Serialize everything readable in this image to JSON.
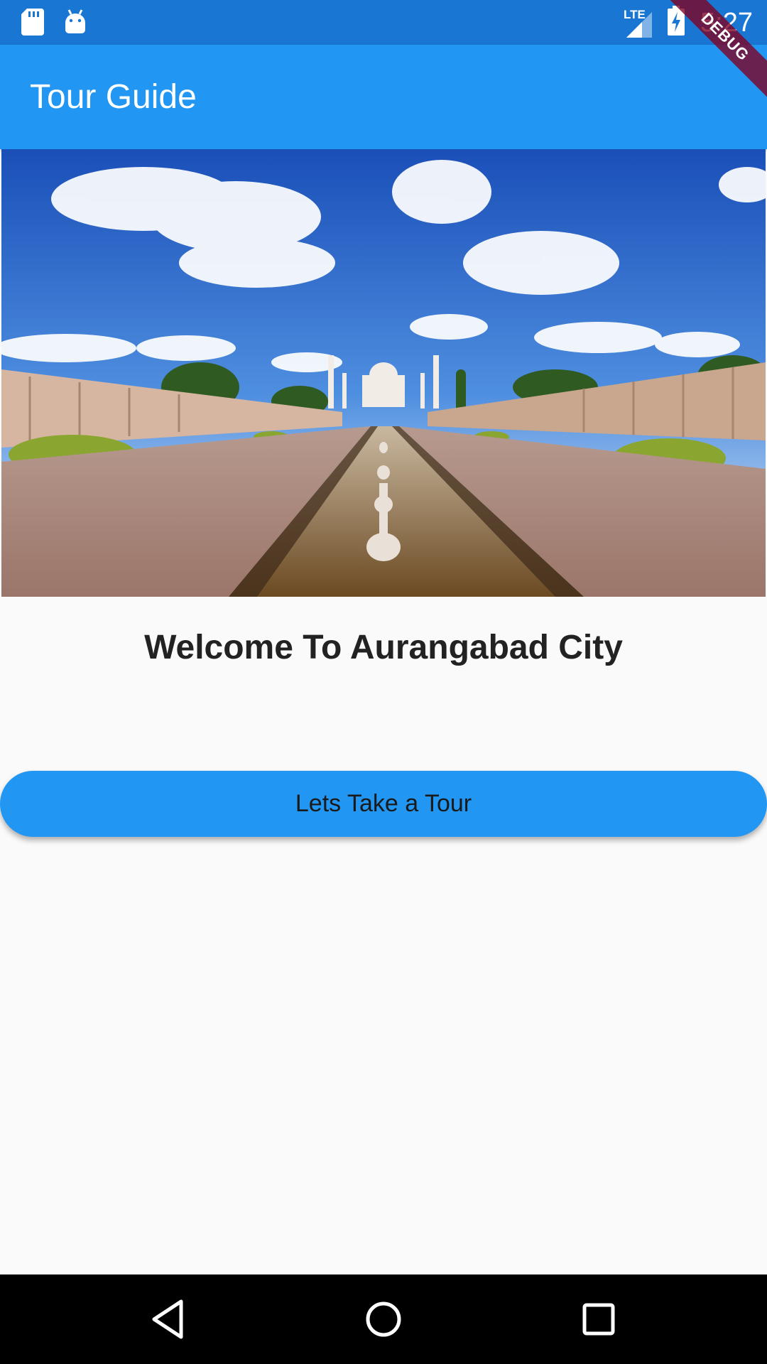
{
  "status_bar": {
    "time": "5:27",
    "network": "LTE",
    "icons": [
      "sd-card-icon",
      "android-icon",
      "signal-icon",
      "battery-charging-icon"
    ]
  },
  "debug_banner": "DEBUG",
  "app_bar": {
    "title": "Tour Guide"
  },
  "hero": {
    "image": "aurangabad-monument-photo"
  },
  "main": {
    "welcome_text": "Welcome To Aurangabad City",
    "tour_button_label": "Lets Take a Tour"
  },
  "nav_bar": {
    "icons": [
      "back-icon",
      "home-icon",
      "recents-icon"
    ]
  },
  "colors": {
    "primary": "#2196f3",
    "status_bar": "#1976d2",
    "background": "#fafafa"
  }
}
